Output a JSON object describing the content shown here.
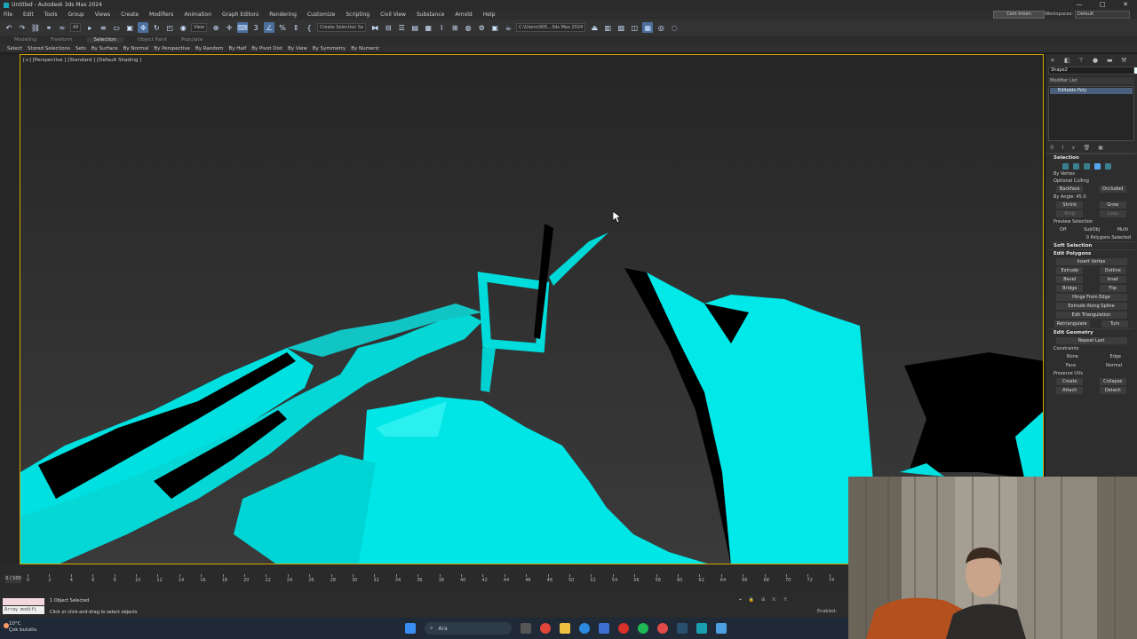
{
  "window": {
    "title": "Untitled - Autodesk 3ds Max 2024",
    "controls": [
      "—",
      "□",
      "✕"
    ]
  },
  "menu": [
    "File",
    "Edit",
    "Tools",
    "Group",
    "Views",
    "Create",
    "Modifiers",
    "Animation",
    "Graph Editors",
    "Rendering",
    "Customize",
    "Scripting",
    "Civil View",
    "Substance",
    "Arnold",
    "Help"
  ],
  "account": {
    "user": "Cem Irmen",
    "workspaces_label": "Workspaces:",
    "workspace": "Default"
  },
  "toolbar": {
    "filter": "All",
    "ref_coord": "View",
    "selection_set": "Create Selection Se",
    "project_path": "C:\\Users\\905...3ds Max 2024"
  },
  "ribbon": {
    "tabs": [
      "Modeling",
      "Freeform",
      "Selection",
      "Object Paint",
      "Populate"
    ],
    "active": "Selection"
  },
  "subribbon": [
    "Select",
    "Stored Selections",
    "Sets",
    "By Surface",
    "By Normal",
    "By Perspective",
    "By Random",
    "By Half",
    "By Pivot Dist",
    "By View",
    "By Symmetry",
    "By Numeric"
  ],
  "viewport": {
    "label": "[+] [Perspective ] [Standard ] [Default Shading ]",
    "accent": "#00e5e5"
  },
  "command_panel": {
    "object_name": "Shape2",
    "modifier_list": "Modifier List",
    "stack": [
      "Editable Poly"
    ],
    "selection": {
      "title": "Selection",
      "by_vertex": "By Vertex",
      "optional_culling": "Optional Culling",
      "backface": "Backface",
      "occluded": "Occluded",
      "by_angle": "By Angle:",
      "angle_value": "45.0",
      "shrink": "Shrink",
      "grow": "Grow",
      "ring": "Ring",
      "loop": "Loop",
      "preview_selection": "Preview Selection",
      "preview_options": [
        "Off",
        "SubObj",
        "Multi"
      ],
      "status": "0 Polygons Selected"
    },
    "soft_selection": "Soft Selection",
    "edit_polygons": {
      "title": "Edit Polygons",
      "insert_vertex": "Insert Vertex",
      "rows": [
        [
          "Extrude",
          "Outline"
        ],
        [
          "Bevel",
          "Inset"
        ],
        [
          "Bridge",
          "Flip"
        ]
      ],
      "hinge": "Hinge From Edge",
      "extrude_spline": "Extrude Along Spline",
      "edit_tri": "Edit Triangulation",
      "retri": "Retriangulate",
      "turn": "Turn"
    },
    "edit_geometry": {
      "title": "Edit Geometry",
      "repeat_last": "Repeat Last",
      "constraints": "Constraints",
      "constraint_opts": [
        [
          "None",
          "Edge"
        ],
        [
          "Face",
          "Normal"
        ]
      ],
      "preserve_uvs": "Preserve UVs",
      "rows": [
        [
          "Create",
          "Collapse"
        ],
        [
          "Attach",
          "Detach"
        ]
      ]
    }
  },
  "timeline": {
    "slider": "0 / 100",
    "ticks": [
      "0",
      "2",
      "4",
      "6",
      "8",
      "10",
      "12",
      "14",
      "16",
      "18",
      "20",
      "22",
      "24",
      "26",
      "28",
      "30",
      "32",
      "34",
      "36",
      "38",
      "40",
      "42",
      "44",
      "46",
      "48",
      "50",
      "52",
      "54",
      "56",
      "58",
      "60",
      "62",
      "64",
      "66",
      "68",
      "70",
      "72",
      "74"
    ]
  },
  "status": {
    "listener": "Array modifi",
    "objects_selected": "1 Object Selected",
    "prompt": "Click or click-and-drag to select objects",
    "x_label": "X:",
    "y_label": "Y:",
    "enabled": "Enabled:"
  },
  "taskbar": {
    "temp": "10°C",
    "weather": "Çok bulutlu",
    "search": "Ara"
  }
}
